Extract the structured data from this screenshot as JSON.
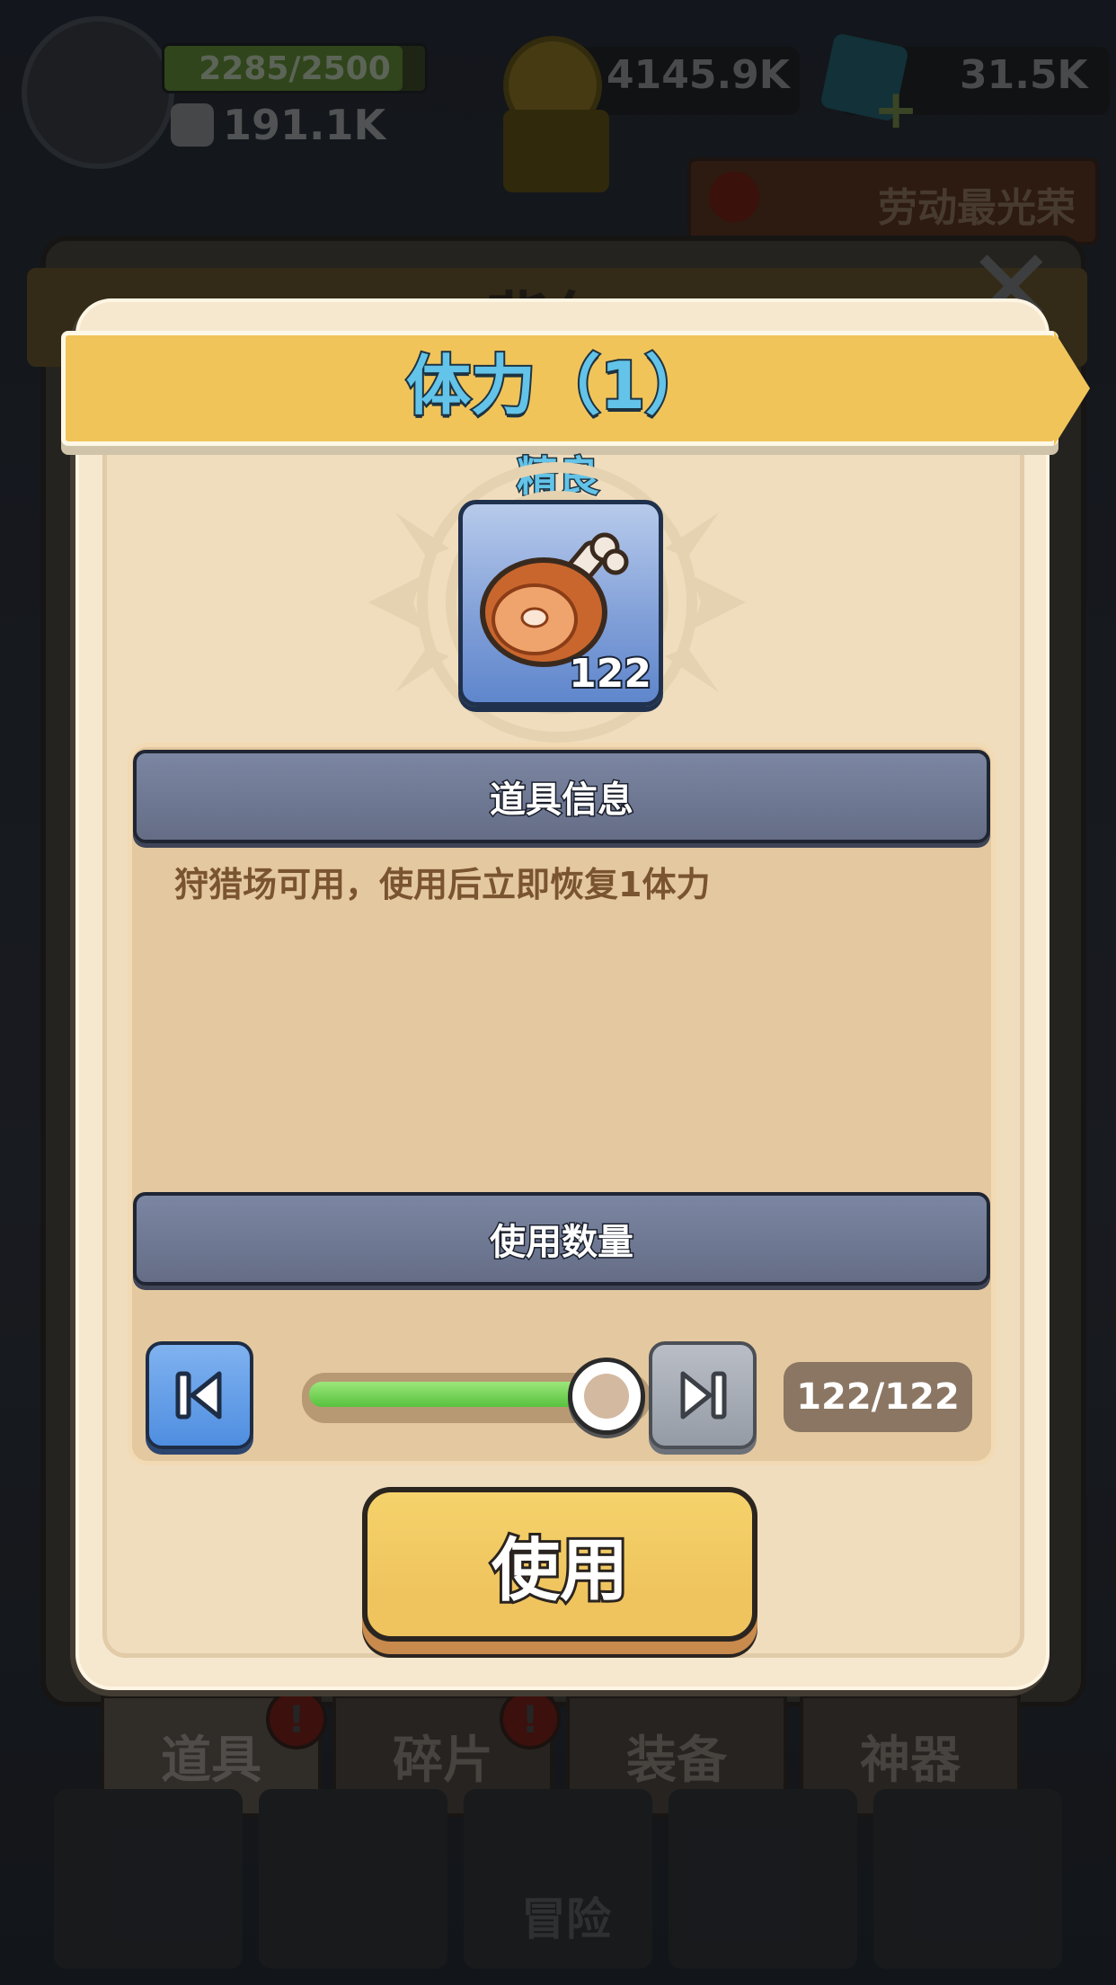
{
  "hud": {
    "stamina_text": "2285/2500",
    "stamina_ratio": 0.914,
    "power": "191.1K",
    "coins": "4145.9K",
    "gems": "31.5K",
    "banner": "劳动最光荣"
  },
  "background_panel": {
    "title": "背包"
  },
  "modal": {
    "title": "体力（1）",
    "rarity": "精良",
    "item": {
      "icon": "meat-leg-icon",
      "count": "122"
    },
    "info_header": "道具信息",
    "description": "狩猎场可用，使用后立即恢复1体力",
    "quantity_header": "使用数量",
    "quantity_text": "122/122",
    "slider_fraction": 1.0,
    "use_button": "使用"
  },
  "tabs": [
    {
      "label": "道具",
      "alert": "!"
    },
    {
      "label": "碎片",
      "alert": "!"
    },
    {
      "label": "装备"
    },
    {
      "label": "神器"
    }
  ],
  "bottom_nav": {
    "center_label": "冒险"
  },
  "colors": {
    "ribbon": "#f1c45a",
    "title_text": "#63c3e8",
    "section_bar": "#6f7893",
    "use_button": "#efc45e",
    "slider_fill": "#58c23e"
  }
}
